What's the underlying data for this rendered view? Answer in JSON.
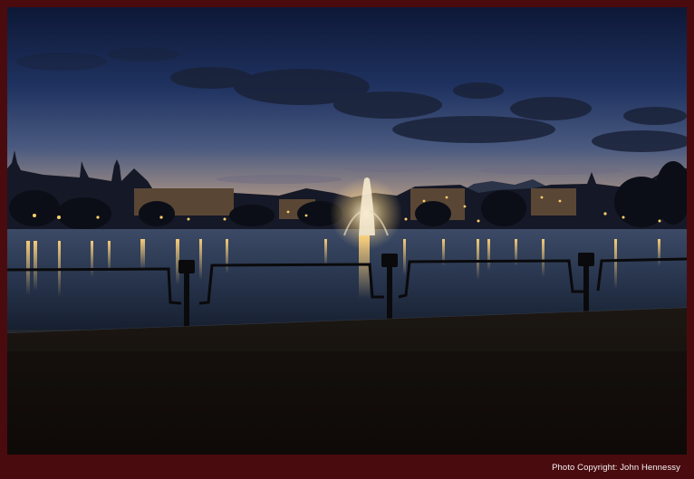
{
  "photo": {
    "subject": "night-lake-scene",
    "colors": {
      "frame": "#4a0b0f",
      "sky_top": "#0f1a3a",
      "sky_horizon": "#c9a27a",
      "water": "#2a3a52",
      "lights": "#ffcf6a",
      "ground": "#15100c"
    }
  },
  "footer": {
    "copyright": "Photo Copyright: John Hennessy"
  }
}
